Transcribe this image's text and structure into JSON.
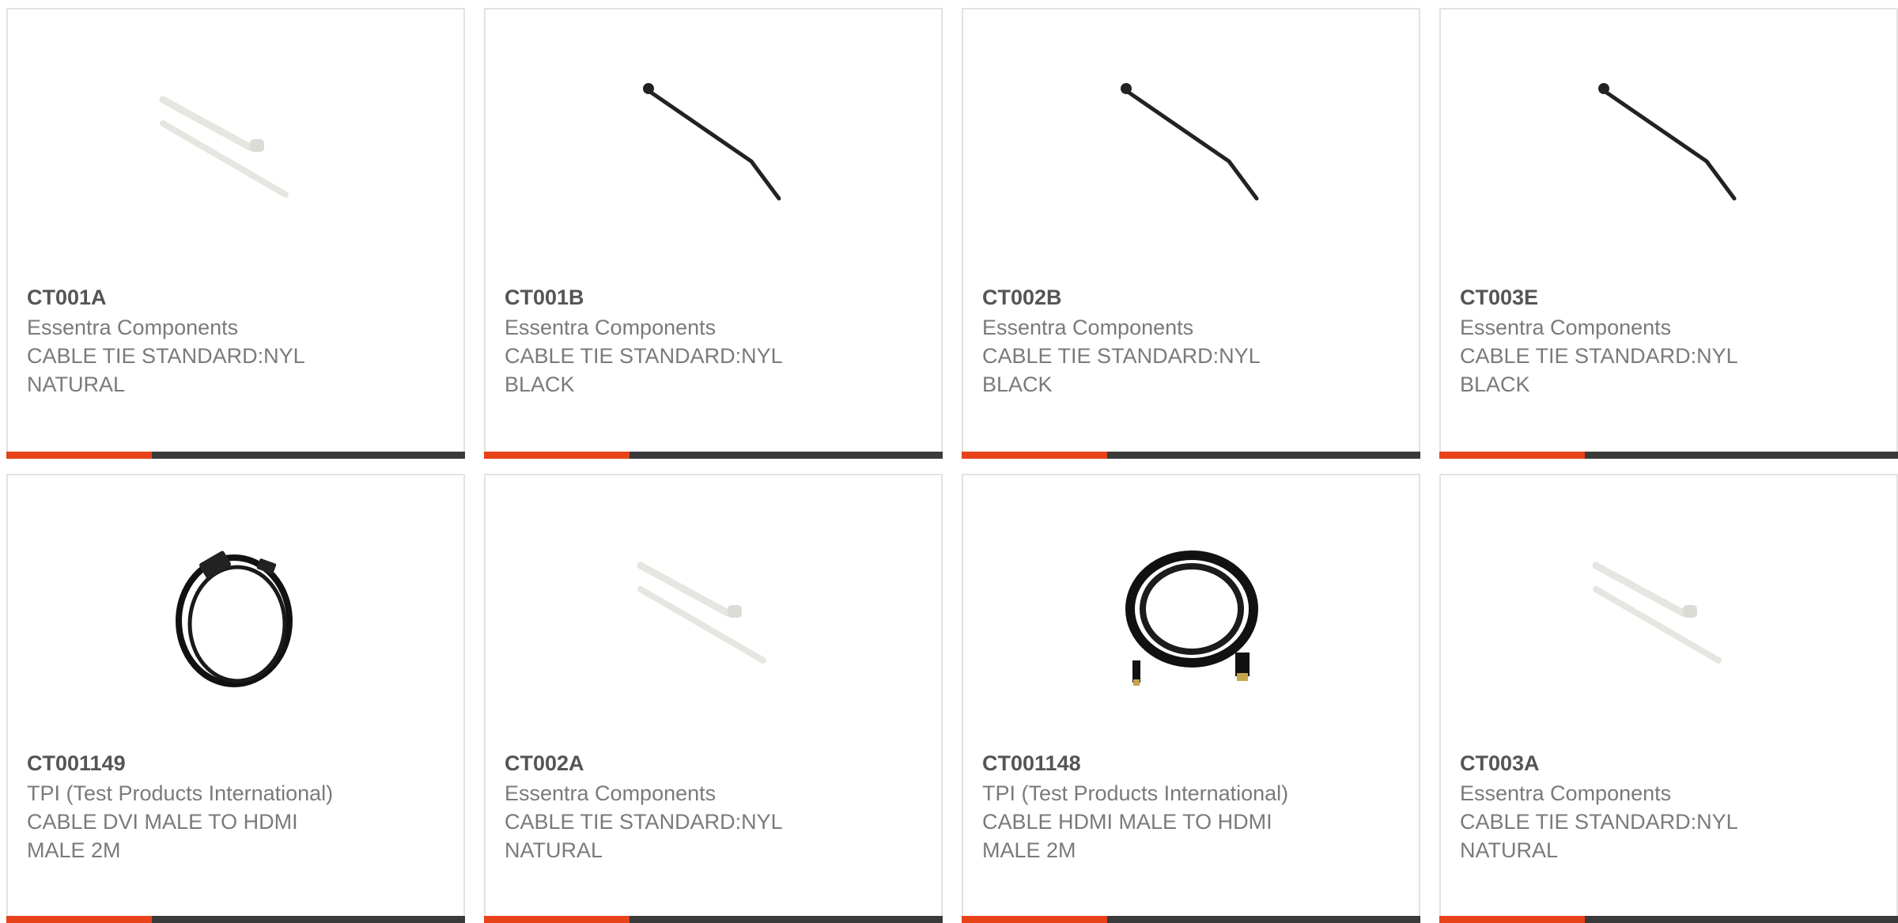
{
  "products": [
    {
      "part": "CT001A",
      "manufacturer": "Essentra Components",
      "description": "CABLE TIE STANDARD:NYL\nNATURAL",
      "image": "cable-tie-natural"
    },
    {
      "part": "CT001B",
      "manufacturer": "Essentra Components",
      "description": "CABLE TIE STANDARD:NYL\nBLACK",
      "image": "cable-tie-black"
    },
    {
      "part": "CT002B",
      "manufacturer": "Essentra Components",
      "description": "CABLE TIE STANDARD:NYL\nBLACK",
      "image": "cable-tie-black"
    },
    {
      "part": "CT003E",
      "manufacturer": "Essentra Components",
      "description": "CABLE TIE STANDARD:NYL\nBLACK",
      "image": "cable-tie-black"
    },
    {
      "part": "CT001149",
      "manufacturer": "TPI (Test Products International)",
      "description": "CABLE DVI MALE TO HDMI\nMALE 2M",
      "image": "cable-coil-dvi"
    },
    {
      "part": "CT002A",
      "manufacturer": "Essentra Components",
      "description": "CABLE TIE STANDARD:NYL\nNATURAL",
      "image": "cable-tie-natural"
    },
    {
      "part": "CT001148",
      "manufacturer": "TPI (Test Products International)",
      "description": "CABLE HDMI MALE TO HDMI\nMALE 2M",
      "image": "cable-coil-hdmi"
    },
    {
      "part": "CT003A",
      "manufacturer": "Essentra Components",
      "description": "CABLE TIE STANDARD:NYL\nNATURAL",
      "image": "cable-tie-natural"
    }
  ],
  "colors": {
    "accent": "#e8421a",
    "bar": "#3a3a3a",
    "text": "#7a7a7a",
    "border": "#e2e2e2"
  }
}
